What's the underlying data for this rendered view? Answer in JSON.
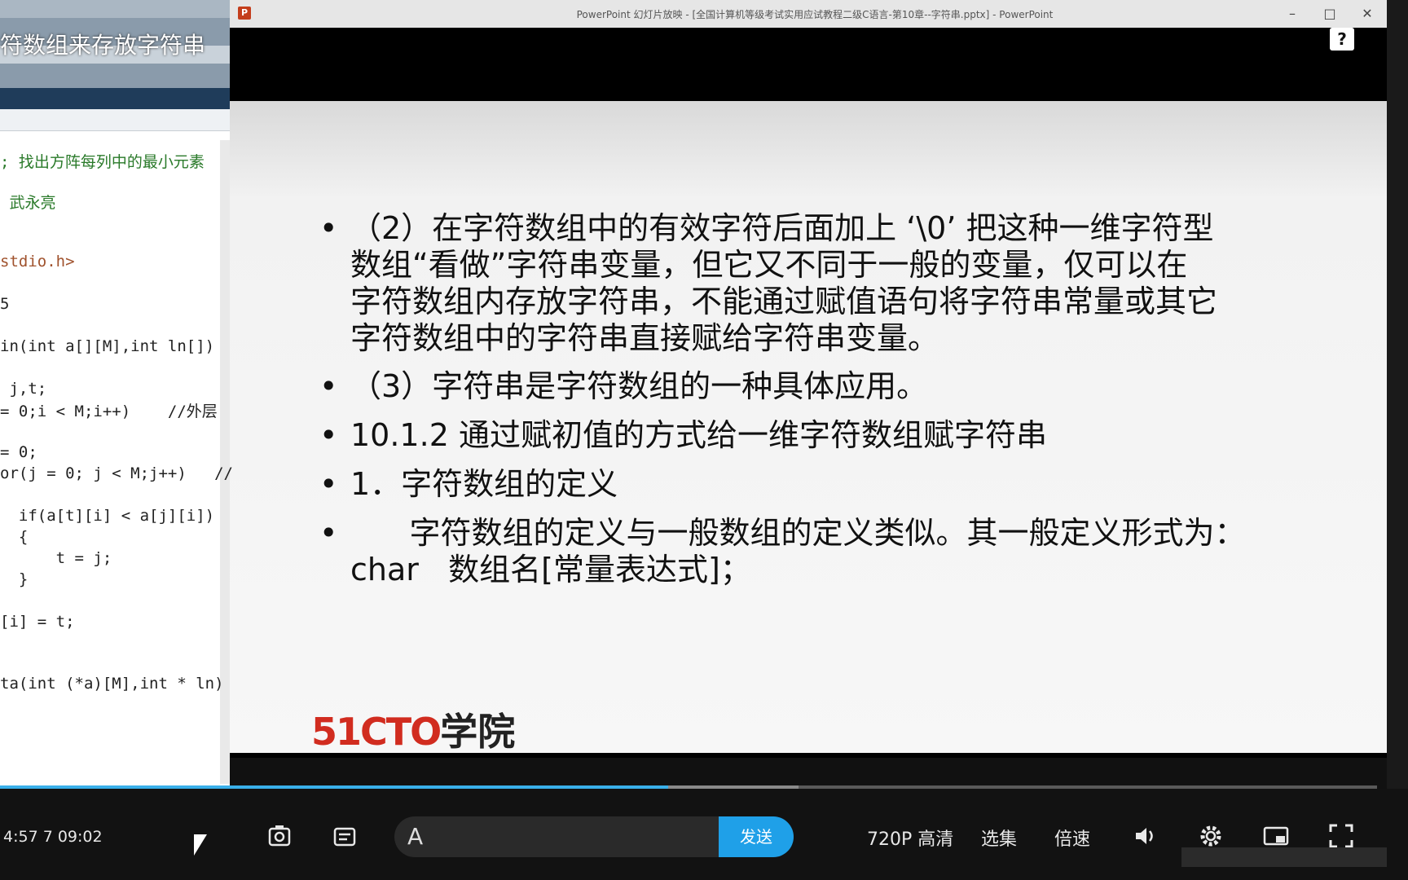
{
  "left_panel": {
    "app_title": "",
    "caption": "符数组来存放字符串",
    "code_lines": [
      {
        "text": "; 找出方阵每列中的最小元素",
        "kind": "comment"
      },
      {
        "text": " 武永亮",
        "kind": "comment"
      },
      {
        "text": "stdio.h>",
        "kind": "incl"
      },
      {
        "text": "5",
        "kind": "code"
      },
      {
        "text": "in(int a[][M],int ln[])",
        "kind": "code"
      },
      {
        "text": " j,t;",
        "kind": "code"
      },
      {
        "text": "= 0;i < M;i++)    //外层",
        "kind": "code"
      },
      {
        "text": "= 0;",
        "kind": "code"
      },
      {
        "text": "or(j = 0; j < M;j++)   //",
        "kind": "code"
      },
      {
        "text": "  if(a[t][i] < a[j][i])",
        "kind": "code"
      },
      {
        "text": "  {",
        "kind": "code"
      },
      {
        "text": "      t = j;",
        "kind": "code"
      },
      {
        "text": "  }",
        "kind": "code"
      },
      {
        "text": "[i] = t;",
        "kind": "code"
      },
      {
        "text": "ta(int (*a)[M],int * ln)",
        "kind": "code"
      }
    ]
  },
  "ppt": {
    "icon_letter": "P",
    "title": "PowerPoint 幻灯片放映 - [全国计算机等级考试实用应试教程二级C语言-第10章--字符串.pptx] - PowerPoint",
    "minimize": "–",
    "maximize": "□",
    "close": "✕",
    "help": "?",
    "slide": {
      "bullets": [
        {
          "dot": "•",
          "text": "（2）在字符数组中的有效字符后面加上 ‘\\0’ 把这种一维字符型\n数组“看做”字符串变量，但它又不同于一般的变量，仅可以在\n字符数组内存放字符串，不能通过赋值语句将字符串常量或其它\n字符数组中的字符串直接赋给字符串变量。"
        },
        {
          "dot": "•",
          "text": "（3）字符串是字符数组的一种具体应用。"
        },
        {
          "dot": "•",
          "text": "10.1.2 通过赋初值的方式给一维字符数组赋字符串"
        },
        {
          "dot": "•",
          "text": "1．字符数组的定义"
        },
        {
          "dot": "•",
          "text": "      字符数组的定义与一般数组的定义类似。其一般定义形式为：\nchar   数组名[常量表达式]；"
        }
      ],
      "logo_number": "51CTO",
      "logo_text": "学院"
    }
  },
  "player": {
    "timecode": "4:57 7 09:02",
    "progress": 0.485,
    "buffered": 0.58,
    "send_label": "发送",
    "quality_label": "720P 高清",
    "episodes_label": "选集",
    "speed_label": "倍速",
    "danmaku_icon": "A",
    "colors": {
      "accent": "#1fa0e8",
      "logo_red": "#d12c1f"
    }
  }
}
